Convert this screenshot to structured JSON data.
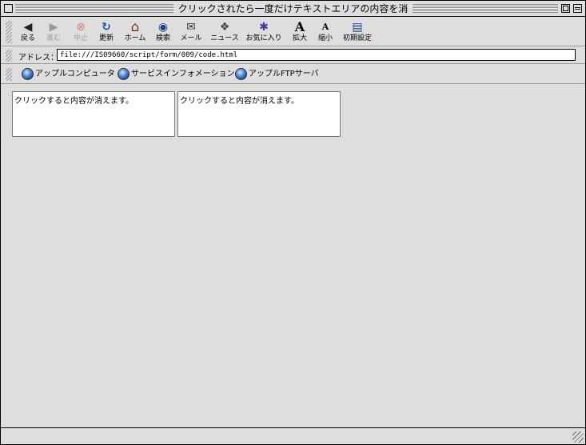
{
  "window": {
    "title": "クリックされたら一度だけテキストエリアの内容を消"
  },
  "toolbar": {
    "buttons": [
      {
        "label": "戻る",
        "icon": "back-arrow-icon",
        "glyph": "◀",
        "enabled": true
      },
      {
        "label": "進む",
        "icon": "forward-arrow-icon",
        "glyph": "▶",
        "enabled": false
      },
      {
        "label": "中止",
        "icon": "stop-icon",
        "glyph": "⊗",
        "enabled": false
      },
      {
        "label": "更新",
        "icon": "refresh-icon",
        "glyph": "↻",
        "enabled": true
      },
      {
        "label": "ホーム",
        "icon": "home-icon",
        "glyph": "⌂",
        "enabled": true
      },
      {
        "label": "検索",
        "icon": "search-globe-icon",
        "glyph": "◉",
        "enabled": true
      },
      {
        "label": "メール",
        "icon": "mail-icon",
        "glyph": "✉",
        "enabled": true
      },
      {
        "label": "ニュース",
        "icon": "news-icon",
        "glyph": "❖",
        "enabled": true
      },
      {
        "label": "お気に入り",
        "icon": "favorites-icon",
        "glyph": "✱",
        "enabled": true
      },
      {
        "label": "拡大",
        "icon": "text-larger-icon",
        "glyph": "A",
        "enabled": true
      },
      {
        "label": "縮小",
        "icon": "text-smaller-icon",
        "glyph": "A",
        "enabled": true
      },
      {
        "label": "初期設定",
        "icon": "preferences-icon",
        "glyph": "▤",
        "enabled": true
      }
    ]
  },
  "address": {
    "label": "アドレス：",
    "url": "file:///IS09660/script/form/009/code.html"
  },
  "favorites": {
    "items": [
      {
        "label": "アップルコンピュータ",
        "icon": "globe-icon"
      },
      {
        "label": "サービスインフォメーション",
        "icon": "globe-icon"
      },
      {
        "label": "アップルFTPサーバ",
        "icon": "globe-icon"
      }
    ]
  },
  "content": {
    "textarea1": "クリックすると内容が消えます。",
    "textarea2": "クリックすると内容が消えます。"
  },
  "colors": {
    "chrome": "#dedede",
    "stop_red": "#d04040",
    "refresh_blue": "#2a4f9a"
  }
}
